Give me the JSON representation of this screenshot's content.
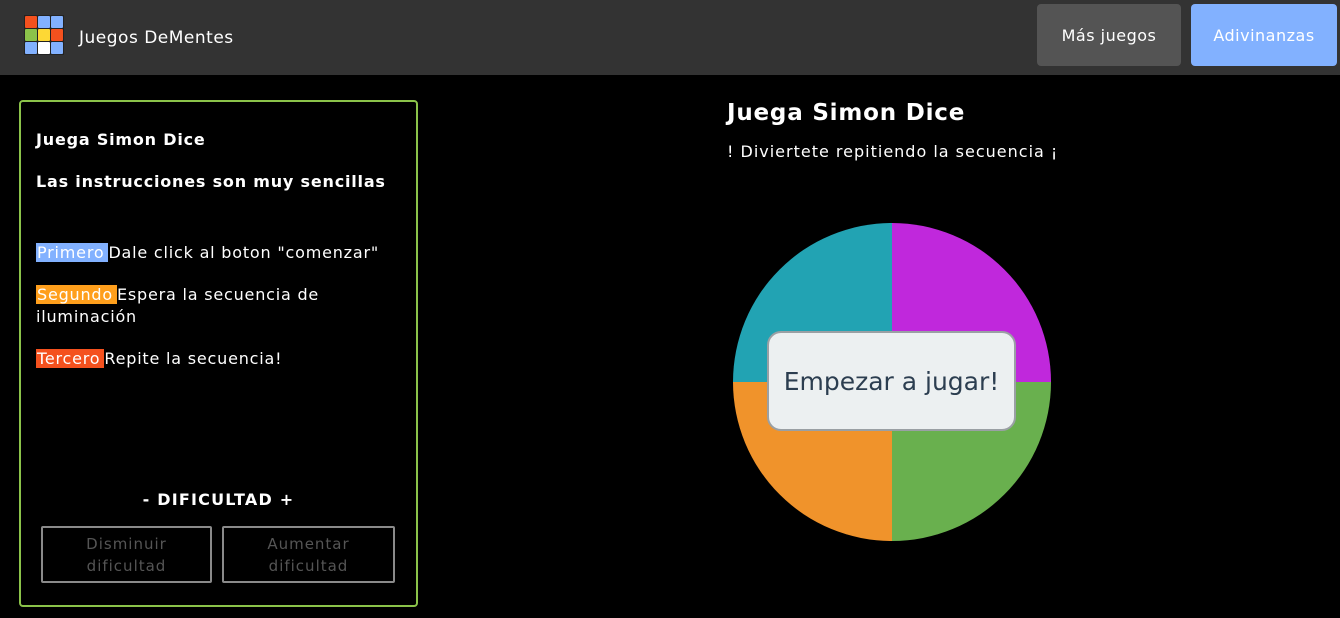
{
  "header": {
    "brand": "Juegos DeMentes",
    "logo_colors": [
      "#f4511e",
      "#82b1ff",
      "#82b1ff",
      "#8bc34a",
      "#fdd835",
      "#f4511e",
      "#82b1ff",
      "#ffffff",
      "#82b1ff"
    ],
    "nav": [
      {
        "label": "Más juegos",
        "color": "#545454"
      },
      {
        "label": "Adivinanzas",
        "color": "#82b1ff"
      }
    ]
  },
  "instructions": {
    "title": "Juega Simon Dice",
    "subtitle": "Las instrucciones son muy sencillas",
    "steps": [
      {
        "tag": "Primero",
        "color": "#82b1ff",
        "text": "Dale click al boton \"comenzar\""
      },
      {
        "tag": "Segundo",
        "color": "#ff9f1c",
        "text": "Espera la secuencia de iluminación"
      },
      {
        "tag": "Tercero",
        "color": "#f4511e",
        "text": "Repite la secuencia!"
      }
    ],
    "difficulty_label": "- DIFICULTAD +",
    "decrease_label": "Disminuir dificultad",
    "increase_label": "Aumentar dificultad"
  },
  "game": {
    "title": "Juega Simon Dice",
    "subtitle": "! Diviertete repitiendo la secuencia ¡",
    "start_label": "Empezar a jugar!",
    "colors": {
      "top_left": "#22a3b3",
      "top_right": "#c028dc",
      "bottom_left": "#f0932b",
      "bottom_right": "#69b04e"
    }
  }
}
